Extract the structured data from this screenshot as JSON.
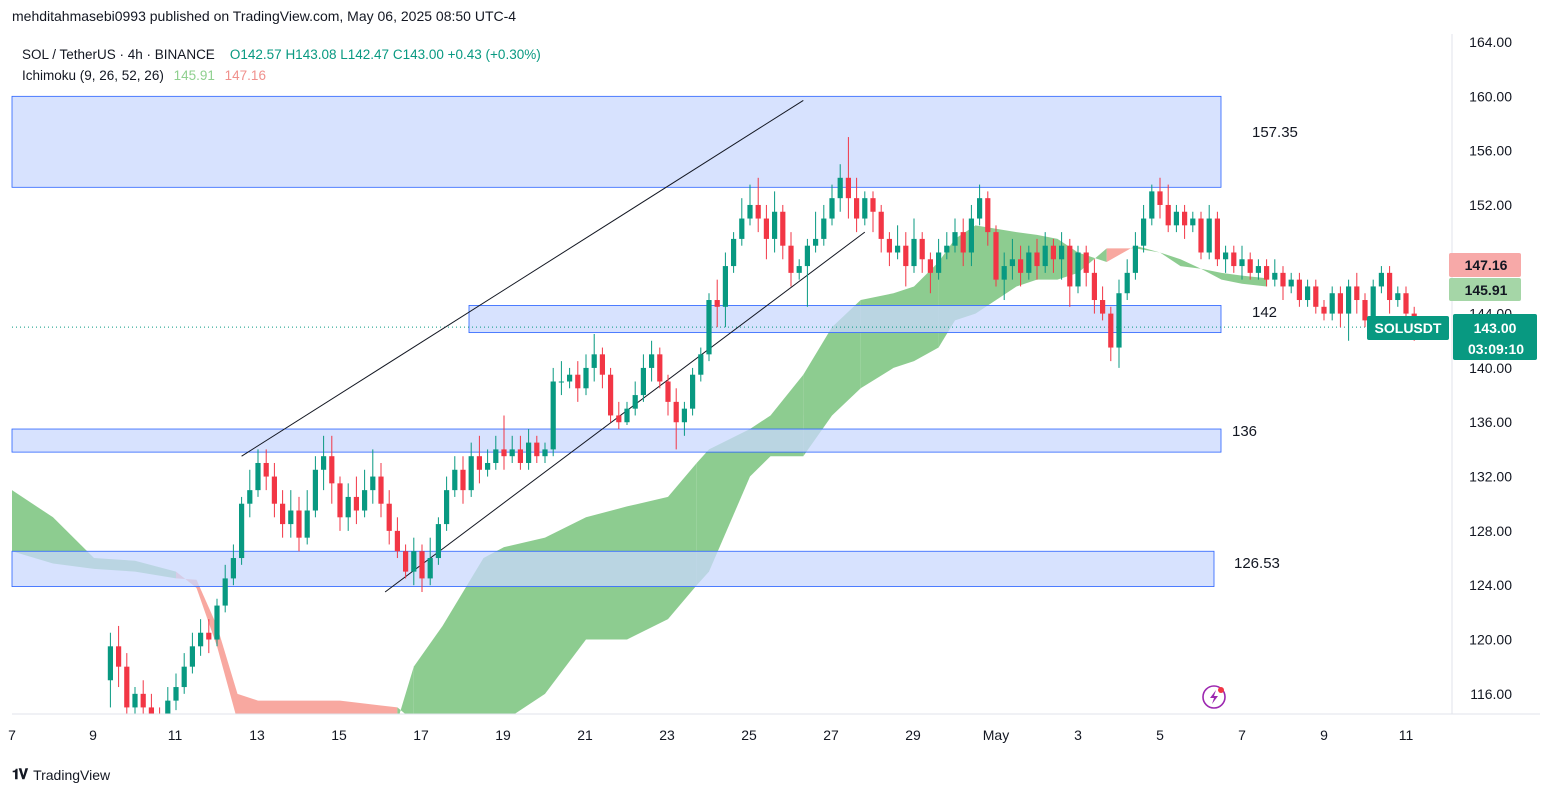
{
  "header": {
    "published": "mehditahmasebi0993 published on TradingView.com, May 06, 2025 08:50 UTC-4",
    "symbol": "SOL / TetherUS · 4h · BINANCE",
    "open": "O142.57",
    "high": "H143.08",
    "low": "L142.47",
    "close": "C143.00",
    "change": "+0.43 (+0.30%)",
    "indicator": "Ichimoku (9, 26, 52, 26)",
    "ichimoku_a": "145.91",
    "ichimoku_b": "147.16"
  },
  "footer": {
    "brand": "TradingView"
  },
  "colors": {
    "up": "#089981",
    "down": "#f23645",
    "cloud_up": "#81c784",
    "cloud_down": "#f7998f",
    "zone": "#c9d8fd",
    "zone_border": "#2962ff"
  },
  "chart_data": {
    "type": "candlestick",
    "price_axis": {
      "min": 113.5,
      "max": 165,
      "ticks": [
        164,
        160,
        156,
        152,
        148,
        144,
        140,
        136,
        132,
        128,
        124,
        120,
        116
      ],
      "tick_labels": [
        "164.00",
        "160.00",
        "156.00",
        "152.00",
        "",
        "144.00",
        "140.00",
        "136.00",
        "132.00",
        "128.00",
        "124.00",
        "120.00",
        "116.00"
      ]
    },
    "time_axis": {
      "labels": [
        "7",
        "9",
        "11",
        "13",
        "15",
        "17",
        "19",
        "21",
        "23",
        "25",
        "27",
        "29",
        "May",
        "3",
        "5",
        "7",
        "9",
        "11"
      ]
    },
    "zones": [
      {
        "label": "157.35",
        "low": 153.3,
        "high": 160.0
      },
      {
        "label": "142",
        "low": 142.6,
        "high": 144.6
      },
      {
        "label": "136",
        "low": 133.8,
        "high": 135.5
      },
      {
        "label": "126.53",
        "low": 123.9,
        "high": 126.5
      }
    ],
    "channel": [
      {
        "from": [
          "12.6",
          133.5
        ],
        "to": [
          "26.3",
          159.7
        ]
      },
      {
        "from": [
          "16.1",
          123.5
        ],
        "to": [
          "27.8",
          150.0
        ]
      }
    ],
    "price_tags": [
      {
        "label": "147.16",
        "value": 147.16,
        "kind": "span_b"
      },
      {
        "label": "145.91",
        "value": 145.91,
        "kind": "span_a"
      },
      {
        "label": "SOLUSDT",
        "value": 143.0,
        "kind": "symbol"
      },
      {
        "label": "143.00",
        "value": 143.0,
        "kind": "last"
      },
      {
        "label": "03:09:10",
        "value": 143.0,
        "kind": "countdown"
      }
    ],
    "last_price": 143.0,
    "cloud": [
      [
        6.4,
        131.8,
        129.0
      ],
      [
        7.0,
        131.0,
        126.5
      ],
      [
        8.0,
        129.0,
        125.6
      ],
      [
        9.0,
        126.0,
        125.2
      ],
      [
        10.0,
        125.8,
        125.0
      ],
      [
        11.0,
        125.0,
        124.5
      ],
      [
        11.5,
        123.8,
        124.4
      ],
      [
        12.0,
        119.5,
        121.0
      ],
      [
        12.5,
        114.0,
        116.0
      ],
      [
        13.0,
        113.5,
        115.5
      ],
      [
        15.0,
        113.5,
        115.5
      ],
      [
        16.4,
        114.0,
        115.0
      ],
      [
        16.8,
        118.0,
        114.0
      ],
      [
        17.5,
        121.0,
        114.0
      ],
      [
        18.5,
        126.0,
        114.0
      ],
      [
        19.0,
        126.8,
        114.0
      ],
      [
        20.0,
        127.5,
        116.0
      ],
      [
        21.0,
        129.0,
        120.0
      ],
      [
        22.0,
        129.8,
        120.0
      ],
      [
        23.0,
        130.5,
        121.5
      ],
      [
        23.7,
        133.0,
        124.0
      ],
      [
        24.0,
        134.0,
        125.0
      ],
      [
        25.0,
        135.5,
        132.0
      ],
      [
        25.5,
        136.5,
        133.5
      ],
      [
        26.3,
        139.5,
        133.5
      ],
      [
        27.0,
        143.0,
        136.5
      ],
      [
        27.7,
        145.0,
        138.5
      ],
      [
        28.5,
        145.5,
        140.0
      ],
      [
        29.0,
        146.0,
        140.5
      ],
      [
        29.6,
        147.8,
        141.5
      ],
      [
        30.0,
        149.5,
        143.5
      ],
      [
        30.5,
        150.5,
        144.0
      ],
      [
        31.5,
        150.0,
        146.0
      ],
      [
        32.0,
        149.8,
        146.5
      ],
      [
        32.5,
        149.5,
        146.5
      ],
      [
        33.0,
        148.5,
        147.0
      ],
      [
        33.7,
        147.8,
        148.8
      ],
      [
        34.4,
        149.0,
        148.8
      ],
      [
        35.0,
        148.5,
        148.5
      ],
      [
        35.5,
        148.0,
        147.5
      ],
      [
        36.0,
        147.3,
        147.3
      ],
      [
        36.5,
        147.0,
        146.5
      ],
      [
        37.0,
        146.8,
        146.2
      ],
      [
        37.6,
        146.6,
        146.0
      ]
    ],
    "candles": [
      [
        9.4,
        117.0,
        119.5,
        115.0,
        120.5
      ],
      [
        9.6,
        119.5,
        118.0,
        116.5,
        121.0
      ],
      [
        9.8,
        118.0,
        115.0,
        114.0,
        119.0
      ],
      [
        10.0,
        115.0,
        116.0,
        114.5,
        116.5
      ],
      [
        10.2,
        116.0,
        115.0,
        114.5,
        117.0
      ],
      [
        10.4,
        115.0,
        114.5,
        113.8,
        116.0
      ],
      [
        10.6,
        114.5,
        114.0,
        113.5,
        115.0
      ],
      [
        10.8,
        114.0,
        115.5,
        113.7,
        116.5
      ],
      [
        11.0,
        115.5,
        116.5,
        114.8,
        117.5
      ],
      [
        11.2,
        116.5,
        118.0,
        116.0,
        119.0
      ],
      [
        11.4,
        118.0,
        119.5,
        117.5,
        120.5
      ],
      [
        11.6,
        119.5,
        120.5,
        118.8,
        121.5
      ],
      [
        11.8,
        120.5,
        120.0,
        119.0,
        121.5
      ],
      [
        12.0,
        120.0,
        122.5,
        119.5,
        123.0
      ],
      [
        12.2,
        122.5,
        124.5,
        122.0,
        125.5
      ],
      [
        12.4,
        124.5,
        126.0,
        124.0,
        127.0
      ],
      [
        12.6,
        126.0,
        130.0,
        125.5,
        130.5
      ],
      [
        12.8,
        130.0,
        131.0,
        129.0,
        132.5
      ],
      [
        13.0,
        131.0,
        133.0,
        130.5,
        134.0
      ],
      [
        13.2,
        133.0,
        132.0,
        131.0,
        134.0
      ],
      [
        13.4,
        132.0,
        130.0,
        129.0,
        133.0
      ],
      [
        13.6,
        130.0,
        128.5,
        127.5,
        131.0
      ],
      [
        13.8,
        128.5,
        129.5,
        127.5,
        131.0
      ],
      [
        14.0,
        129.5,
        127.5,
        126.5,
        130.5
      ],
      [
        14.2,
        127.5,
        129.5,
        127.0,
        131.0
      ],
      [
        14.4,
        129.5,
        132.5,
        129.0,
        133.5
      ],
      [
        14.6,
        132.5,
        133.5,
        131.0,
        135.0
      ],
      [
        14.8,
        133.5,
        131.5,
        130.0,
        135.0
      ],
      [
        15.0,
        131.5,
        129.0,
        128.0,
        132.0
      ],
      [
        15.2,
        129.0,
        130.5,
        128.0,
        131.5
      ],
      [
        15.4,
        130.5,
        129.5,
        128.5,
        132.0
      ],
      [
        15.6,
        129.5,
        131.0,
        129.0,
        132.5
      ],
      [
        15.8,
        131.0,
        132.0,
        130.0,
        134.0
      ],
      [
        16.0,
        132.0,
        130.0,
        129.0,
        133.0
      ],
      [
        16.2,
        130.0,
        128.0,
        127.0,
        131.0
      ],
      [
        16.4,
        128.0,
        126.5,
        126.0,
        129.0
      ],
      [
        16.6,
        126.5,
        125.0,
        124.5,
        127.0
      ],
      [
        16.8,
        125.0,
        126.5,
        124.0,
        127.5
      ],
      [
        17.0,
        126.5,
        124.5,
        123.5,
        127.0
      ],
      [
        17.2,
        124.5,
        126.0,
        124.0,
        127.5
      ],
      [
        17.4,
        126.0,
        128.5,
        125.5,
        129.0
      ],
      [
        17.6,
        128.5,
        131.0,
        128.0,
        132.0
      ],
      [
        17.8,
        131.0,
        132.5,
        130.5,
        133.5
      ],
      [
        18.0,
        132.5,
        131.0,
        130.0,
        133.5
      ],
      [
        18.2,
        131.0,
        133.5,
        130.5,
        134.5
      ],
      [
        18.4,
        133.5,
        132.5,
        131.5,
        135.0
      ],
      [
        18.6,
        132.5,
        133.0,
        132.0,
        134.0
      ],
      [
        18.8,
        133.0,
        134.0,
        132.5,
        135.0
      ],
      [
        19.0,
        134.0,
        133.5,
        132.5,
        136.5
      ],
      [
        19.2,
        133.5,
        134.0,
        133.0,
        135.0
      ],
      [
        19.4,
        134.0,
        133.0,
        132.5,
        135.0
      ],
      [
        19.6,
        133.0,
        134.5,
        132.5,
        135.5
      ],
      [
        19.8,
        134.5,
        133.5,
        133.0,
        135.0
      ],
      [
        20.0,
        133.5,
        134.0,
        133.0,
        134.5
      ],
      [
        20.2,
        134.0,
        139.0,
        133.5,
        140.0
      ],
      [
        20.4,
        139.0,
        139.0,
        138.0,
        140.5
      ],
      [
        20.6,
        139.0,
        139.5,
        138.5,
        140.0
      ],
      [
        20.8,
        139.5,
        138.5,
        137.5,
        140.5
      ],
      [
        21.0,
        138.5,
        140.0,
        138.0,
        141.0
      ],
      [
        21.2,
        140.0,
        141.0,
        139.0,
        142.5
      ],
      [
        21.4,
        141.0,
        139.5,
        138.5,
        141.5
      ],
      [
        21.6,
        139.5,
        136.5,
        136.0,
        140.0
      ],
      [
        21.8,
        136.5,
        136.0,
        135.5,
        137.5
      ],
      [
        22.0,
        136.0,
        137.0,
        135.8,
        137.5
      ],
      [
        22.2,
        137.0,
        138.0,
        136.5,
        139.0
      ],
      [
        22.4,
        138.0,
        140.0,
        137.5,
        141.0
      ],
      [
        22.6,
        140.0,
        141.0,
        139.0,
        142.0
      ],
      [
        22.8,
        141.0,
        139.0,
        138.5,
        141.5
      ],
      [
        23.0,
        139.0,
        137.5,
        136.5,
        139.5
      ],
      [
        23.2,
        137.5,
        136.0,
        134.0,
        138.5
      ],
      [
        23.4,
        136.0,
        137.0,
        135.0,
        137.5
      ],
      [
        23.6,
        137.0,
        139.5,
        136.5,
        140.0
      ],
      [
        23.8,
        139.5,
        141.0,
        139.0,
        141.5
      ],
      [
        24.0,
        141.0,
        145.0,
        140.5,
        145.5
      ],
      [
        24.2,
        145.0,
        144.5,
        143.0,
        146.5
      ],
      [
        24.4,
        144.5,
        147.5,
        143.0,
        148.5
      ],
      [
        24.6,
        147.5,
        149.5,
        147.0,
        150.0
      ],
      [
        24.8,
        149.5,
        151.0,
        149.0,
        152.5
      ],
      [
        25.0,
        151.0,
        152.0,
        150.5,
        153.5
      ],
      [
        25.2,
        152.0,
        151.0,
        150.0,
        154.0
      ],
      [
        25.4,
        151.0,
        149.5,
        148.0,
        152.0
      ],
      [
        25.6,
        149.5,
        151.5,
        148.5,
        153.0
      ],
      [
        25.8,
        151.5,
        149.0,
        148.0,
        152.0
      ],
      [
        26.0,
        149.0,
        147.0,
        146.0,
        150.0
      ],
      [
        26.2,
        147.0,
        147.5,
        146.5,
        148.0
      ],
      [
        26.4,
        147.5,
        149.0,
        144.5,
        149.5
      ],
      [
        26.6,
        149.0,
        149.5,
        148.5,
        151.5
      ],
      [
        26.8,
        149.5,
        151.0,
        149.0,
        152.0
      ],
      [
        27.0,
        151.0,
        152.5,
        150.5,
        153.5
      ],
      [
        27.2,
        152.5,
        154.0,
        151.5,
        155.0
      ],
      [
        27.4,
        154.0,
        152.5,
        151.0,
        157.0
      ],
      [
        27.6,
        152.5,
        151.0,
        150.0,
        154.0
      ],
      [
        27.8,
        151.0,
        152.5,
        150.5,
        153.0
      ],
      [
        28.0,
        152.5,
        151.5,
        150.0,
        153.0
      ],
      [
        28.2,
        151.5,
        149.5,
        148.5,
        152.0
      ],
      [
        28.4,
        149.5,
        148.5,
        147.5,
        150.0
      ],
      [
        28.6,
        148.5,
        149.0,
        148.0,
        150.5
      ],
      [
        28.8,
        149.0,
        147.5,
        146.0,
        150.0
      ],
      [
        29.0,
        147.5,
        149.5,
        147.0,
        151.0
      ],
      [
        29.2,
        149.5,
        148.0,
        147.0,
        150.0
      ],
      [
        29.4,
        148.0,
        147.0,
        145.5,
        148.5
      ],
      [
        29.6,
        147.0,
        148.5,
        146.5,
        149.5
      ],
      [
        29.8,
        148.5,
        149.0,
        148.0,
        150.0
      ],
      [
        30.0,
        149.0,
        150.0,
        148.5,
        151.0
      ],
      [
        30.2,
        150.0,
        148.5,
        147.5,
        151.0
      ],
      [
        30.4,
        148.5,
        151.0,
        147.5,
        152.0
      ],
      [
        30.6,
        151.0,
        152.5,
        150.5,
        153.5
      ],
      [
        30.8,
        152.5,
        150.0,
        149.0,
        153.0
      ],
      [
        31.0,
        150.0,
        146.5,
        146.0,
        150.5
      ],
      [
        31.2,
        146.5,
        147.5,
        145.0,
        148.5
      ],
      [
        31.4,
        147.5,
        148.0,
        146.5,
        149.5
      ],
      [
        31.6,
        148.0,
        147.0,
        146.0,
        149.0
      ],
      [
        31.8,
        147.0,
        148.5,
        146.5,
        149.0
      ],
      [
        32.0,
        148.5,
        147.5,
        146.5,
        149.5
      ],
      [
        32.2,
        147.5,
        149.0,
        147.0,
        150.0
      ],
      [
        32.4,
        149.0,
        148.0,
        147.0,
        149.5
      ],
      [
        32.6,
        148.0,
        149.0,
        146.5,
        150.0
      ],
      [
        32.8,
        149.0,
        146.0,
        144.5,
        149.5
      ],
      [
        33.0,
        146.0,
        148.5,
        145.5,
        149.0
      ],
      [
        33.2,
        148.5,
        147.0,
        146.0,
        149.0
      ],
      [
        33.4,
        147.0,
        145.0,
        144.0,
        148.0
      ],
      [
        33.6,
        145.0,
        144.0,
        143.5,
        146.0
      ],
      [
        33.8,
        144.0,
        141.5,
        140.5,
        144.5
      ],
      [
        34.0,
        141.5,
        145.5,
        140.0,
        146.5
      ],
      [
        34.2,
        145.5,
        147.0,
        145.0,
        148.0
      ],
      [
        34.4,
        147.0,
        149.0,
        146.5,
        150.0
      ],
      [
        34.6,
        149.0,
        151.0,
        148.5,
        152.0
      ],
      [
        34.8,
        151.0,
        153.0,
        150.5,
        153.5
      ],
      [
        35.0,
        153.0,
        152.0,
        151.0,
        154.0
      ],
      [
        35.2,
        152.0,
        150.5,
        150.0,
        153.5
      ],
      [
        35.4,
        150.5,
        151.5,
        150.0,
        152.0
      ],
      [
        35.6,
        151.5,
        150.5,
        149.5,
        152.0
      ],
      [
        35.8,
        150.5,
        151.0,
        150.0,
        151.5
      ],
      [
        36.0,
        151.0,
        148.5,
        148.0,
        151.5
      ],
      [
        36.2,
        148.5,
        151.0,
        148.0,
        152.0
      ],
      [
        36.4,
        151.0,
        148.0,
        147.5,
        151.5
      ],
      [
        36.6,
        148.0,
        148.5,
        147.0,
        149.0
      ],
      [
        36.8,
        148.5,
        147.5,
        147.0,
        149.0
      ],
      [
        37.0,
        147.5,
        148.0,
        146.5,
        149.0
      ],
      [
        37.2,
        148.0,
        147.0,
        146.5,
        148.5
      ],
      [
        37.4,
        147.0,
        147.5,
        146.5,
        148.0
      ],
      [
        37.6,
        147.5,
        146.5,
        146.0,
        148.0
      ],
      [
        37.8,
        146.5,
        147.0,
        146.0,
        148.0
      ],
      [
        38.0,
        147.0,
        146.0,
        145.0,
        147.5
      ],
      [
        38.2,
        146.0,
        146.5,
        145.5,
        147.0
      ],
      [
        38.4,
        146.5,
        145.0,
        144.5,
        147.0
      ],
      [
        38.6,
        145.0,
        146.0,
        144.5,
        146.5
      ],
      [
        38.8,
        146.0,
        144.5,
        144.0,
        146.5
      ],
      [
        39.0,
        144.5,
        144.0,
        143.5,
        145.0
      ],
      [
        39.2,
        144.0,
        145.5,
        143.5,
        146.0
      ],
      [
        39.4,
        145.5,
        144.0,
        143.0,
        146.0
      ],
      [
        39.6,
        144.0,
        146.0,
        142.0,
        146.5
      ],
      [
        39.8,
        146.0,
        145.0,
        144.0,
        147.0
      ],
      [
        40.0,
        145.0,
        143.5,
        143.0,
        145.5
      ],
      [
        40.2,
        143.5,
        146.0,
        143.0,
        146.5
      ],
      [
        40.4,
        146.0,
        147.0,
        145.5,
        147.5
      ],
      [
        40.6,
        147.0,
        145.0,
        144.0,
        147.5
      ],
      [
        40.8,
        145.0,
        145.5,
        144.5,
        146.0
      ],
      [
        41.0,
        145.5,
        144.0,
        143.5,
        146.0
      ],
      [
        41.2,
        144.0,
        142.5,
        142.0,
        144.5
      ],
      [
        41.4,
        142.57,
        143.0,
        142.47,
        143.08
      ]
    ]
  }
}
